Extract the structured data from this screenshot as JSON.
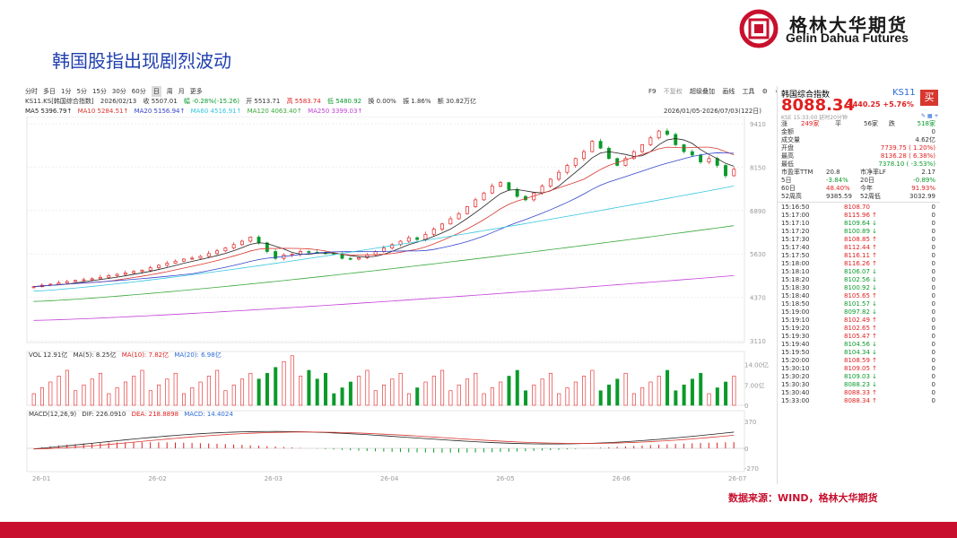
{
  "brand": {
    "cn": "格林大华期货",
    "en": "Gelin Dahua Futures",
    "color": "#c8102e"
  },
  "slide_title": "韩国股指出现剧烈波动",
  "source": "数据来源：WIND，格林大华期货",
  "toolbar": {
    "periods": [
      "分时",
      "多日",
      "1分",
      "5分",
      "15分",
      "30分",
      "60分",
      "日",
      "周",
      "月",
      "更多"
    ],
    "selected": "日",
    "right": [
      "F9",
      "不复权",
      "超级叠加",
      "画线",
      "工具"
    ]
  },
  "info": {
    "code": "KS11.KS[韩国综合指数]",
    "date": "2026/02/13",
    "close": "收 5507.01",
    "change": "幅 -0.28%(-15.26)",
    "open": "开 5513.71",
    "high": "高 5583.74",
    "low": "低 5480.92",
    "turnover": "换 0.00%",
    "amp": "振 1.86%",
    "amount": "额 30.82万亿"
  },
  "ma_line": {
    "ma5": "MA5 5396.79↑",
    "ma10": "MA10 5284.51↑",
    "ma20": "MA20 5156.94↑",
    "ma60": "MA60 4516.91↑",
    "ma120": "MA120 4063.40↑",
    "ma250": "MA250 3399.03↑"
  },
  "date_range": "2026/01/05-2026/07/03(122日)",
  "vol_label": {
    "vol": "VOL 12.91亿",
    "ma5": "MA(5): 8.25亿",
    "ma10": "MA(10): 7.82亿",
    "ma20": "MA(20): 6.98亿"
  },
  "macd_label": {
    "title": "MACD(12,26,9)",
    "dif": "DIF: 226.0910",
    "dea": "DEA: 218.8898",
    "macd": "MACD: 14.4024"
  },
  "chart_data": {
    "type": "candlestick",
    "price_axis_ticks": [
      "9410",
      "8150",
      "6890",
      "5630",
      "4370",
      "3110"
    ],
    "price_range": [
      3110,
      9410
    ],
    "vol_axis_ticks": [
      "14.00亿",
      "7.00亿",
      "0"
    ],
    "macd_axis_ticks": [
      "370",
      "0",
      "-270"
    ],
    "x_ticks": [
      "26-01",
      "26-02",
      "26-03",
      "26-04",
      "26-05",
      "26-06",
      "26-07"
    ],
    "close_path": [
      4680,
      4720,
      4750,
      4790,
      4830,
      4860,
      4880,
      4910,
      4950,
      5000,
      5040,
      5080,
      5120,
      5160,
      5230,
      5300,
      5360,
      5420,
      5480,
      5507,
      5560,
      5640,
      5720,
      5800,
      5900,
      6000,
      6120,
      5950,
      5700,
      5500,
      5600,
      5620,
      5700,
      5680,
      5660,
      5640,
      5620,
      5500,
      5480,
      5520,
      5600,
      5700,
      5800,
      5900,
      6000,
      6100,
      6050,
      6200,
      6350,
      6500,
      6650,
      6800,
      7000,
      7200,
      7400,
      7600,
      7700,
      7500,
      7300,
      7200,
      7400,
      7600,
      7800,
      8000,
      8200,
      8400,
      8600,
      8900,
      8700,
      8400,
      8200,
      8400,
      8600,
      8800,
      9000,
      9200,
      9100,
      8800,
      8600,
      8500,
      8300,
      8400,
      8200,
      7900,
      8088
    ],
    "ma_colors": {
      "ma5": "#222222",
      "ma10": "#d8372f",
      "ma20": "#3344cc",
      "ma60": "#35c6e0",
      "ma120": "#39a83a",
      "ma250": "#c23fd6"
    }
  },
  "quote": {
    "name": "韩国综合指数",
    "code": "KS11",
    "buy": "买",
    "price": "8088.34",
    "change": "+440.25",
    "change_pct": "+5.76%",
    "sub": "KSE  15:33:00  延时20分钟",
    "stats": [
      {
        "l": "涨",
        "lv": "249家",
        "m": "平",
        "mv": "56家",
        "r": "跌",
        "rv": "518家"
      }
    ],
    "rows": [
      {
        "l": "金额",
        "r": "0"
      },
      {
        "l": "成交量",
        "r": "4.62亿"
      },
      {
        "l": "开盘",
        "r": "7739.75 ( 1.20%)"
      },
      {
        "l": "最高",
        "r": "8136.28 ( 6.38%)"
      },
      {
        "l": "最低",
        "r": "7378.10 ( -3.53%)"
      }
    ],
    "ratios": [
      {
        "l": "市盈率TTM",
        "lv": "20.8",
        "m": "市净率LF",
        "mv": "2.17"
      },
      {
        "l": "5日",
        "lv": "-3.84%",
        "m": "20日",
        "mv": "-0.89%"
      },
      {
        "l": "60日",
        "lv": "48.40%",
        "m": "今年",
        "mv": "91.93%"
      },
      {
        "l": "52周高",
        "lv": "9385.59",
        "m": "52周低",
        "mv": "3032.99"
      }
    ],
    "ticks": [
      {
        "t": "15:16:50",
        "p": "8108.70",
        "v": "0"
      },
      {
        "t": "15:17:00",
        "p": "8115.96 ↑",
        "v": "0"
      },
      {
        "t": "15:17:10",
        "p": "8109.64 ↓",
        "v": "0"
      },
      {
        "t": "15:17:20",
        "p": "8100.89 ↓",
        "v": "0"
      },
      {
        "t": "15:17:30",
        "p": "8108.85 ↑",
        "v": "0"
      },
      {
        "t": "15:17:40",
        "p": "8112.44 ↑",
        "v": "0"
      },
      {
        "t": "15:17:50",
        "p": "8116.11 ↑",
        "v": "0"
      },
      {
        "t": "15:18:00",
        "p": "8116.26 ↑",
        "v": "0"
      },
      {
        "t": "15:18:10",
        "p": "8106.07 ↓",
        "v": "0"
      },
      {
        "t": "15:18:20",
        "p": "8102.56 ↓",
        "v": "0"
      },
      {
        "t": "15:18:30",
        "p": "8100.92 ↓",
        "v": "0"
      },
      {
        "t": "15:18:40",
        "p": "8105.65 ↑",
        "v": "0"
      },
      {
        "t": "15:18:50",
        "p": "8101.57 ↓",
        "v": "0"
      },
      {
        "t": "15:19:00",
        "p": "8097.82 ↓",
        "v": "0"
      },
      {
        "t": "15:19:10",
        "p": "8102.49 ↑",
        "v": "0"
      },
      {
        "t": "15:19:20",
        "p": "8102.65 ↑",
        "v": "0"
      },
      {
        "t": "15:19:30",
        "p": "8105.47 ↑",
        "v": "0"
      },
      {
        "t": "15:19:40",
        "p": "8104.56 ↓",
        "v": "0"
      },
      {
        "t": "15:19:50",
        "p": "8104.34 ↓",
        "v": "0"
      },
      {
        "t": "15:20:00",
        "p": "8108.59 ↑",
        "v": "0"
      },
      {
        "t": "15:30:10",
        "p": "8109.05 ↑",
        "v": "0"
      },
      {
        "t": "15:30:20",
        "p": "8109.03 ↓",
        "v": "0"
      },
      {
        "t": "15:30:30",
        "p": "8088.23 ↓",
        "v": "0"
      },
      {
        "t": "15:30:40",
        "p": "8088.33 ↑",
        "v": "0"
      },
      {
        "t": "15:33:00",
        "p": "8088.34 ↑",
        "v": "0"
      }
    ]
  }
}
